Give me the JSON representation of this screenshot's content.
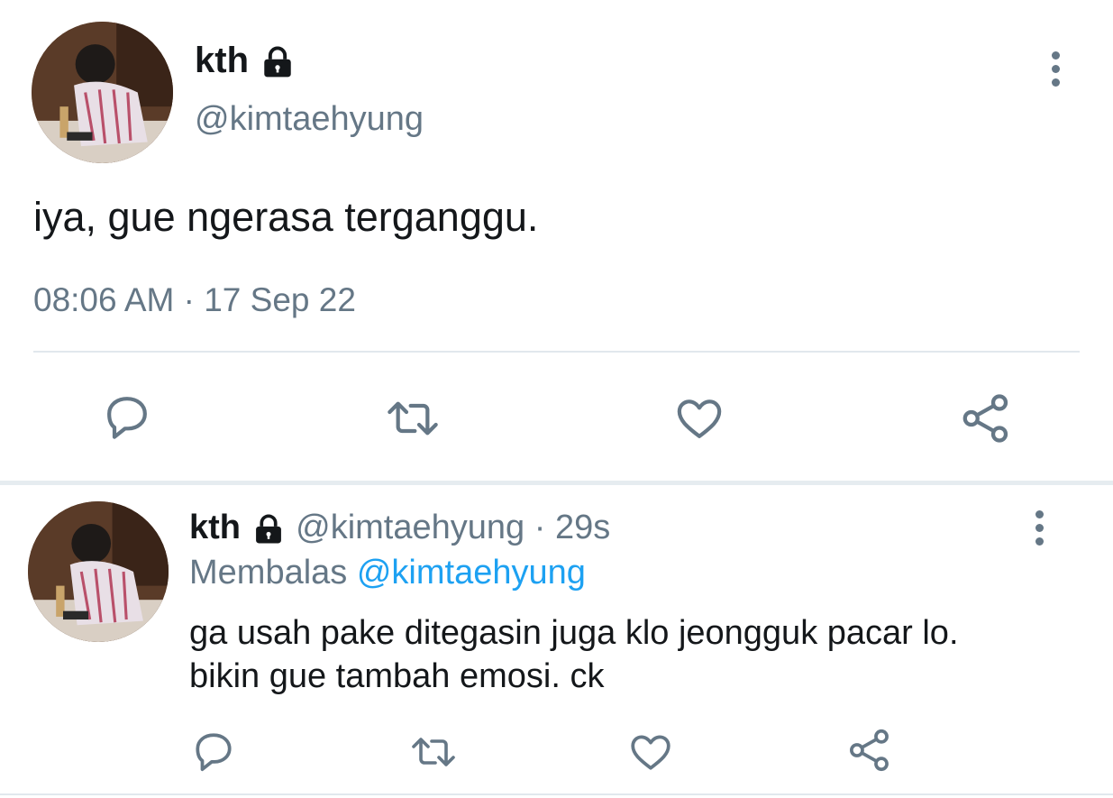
{
  "main_tweet": {
    "display_name": "kth",
    "handle": "@kimtaehyung",
    "text": "iya, gue ngerasa terganggu.",
    "timestamp": "08:06 AM · 17 Sep 22",
    "icons": [
      "reply-icon",
      "retweet-icon",
      "like-icon",
      "share-icon"
    ]
  },
  "reply_tweet": {
    "display_name": "kth",
    "handle": "@kimtaehyung",
    "separator": "·",
    "age": "29s",
    "replying_label": "Membalas",
    "replying_to": "@kimtaehyung",
    "text_line1": "ga usah pake ditegasin juga klo jeongguk pacar lo.",
    "text_line2": "bikin gue tambah emosi. ck",
    "icons": [
      "reply-icon",
      "retweet-icon",
      "like-icon",
      "share-icon"
    ]
  },
  "colors": {
    "text": "#14171a",
    "secondary": "#657786",
    "link": "#1da1f2",
    "divider": "#e1e8ed"
  }
}
